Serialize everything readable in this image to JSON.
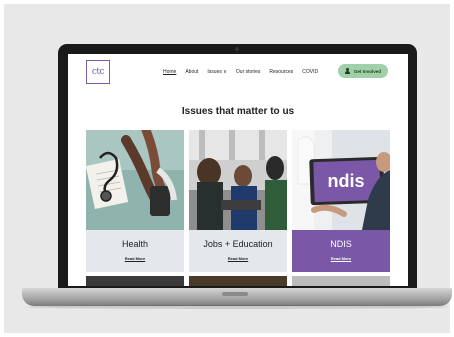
{
  "site": {
    "logo_text": "ctc",
    "nav": [
      "Home",
      "About",
      "Issues ∨",
      "Our stories",
      "Resources",
      "COVID"
    ],
    "cta_label": "Get Involved",
    "section_heading": "Issues that matter to us",
    "cards": [
      {
        "title": "Health",
        "link": "Read More"
      },
      {
        "title": "Jobs + Education",
        "link": "Read More"
      },
      {
        "title": "NDIS",
        "link": "Read More"
      }
    ],
    "ndis_logo": "ndis"
  },
  "colors": {
    "accent_purple": "#7b57a8",
    "cta_green": "#9fd0a8",
    "panel_grey": "#e4e7ec"
  },
  "icons": {
    "cta_icon": "user-icon"
  }
}
